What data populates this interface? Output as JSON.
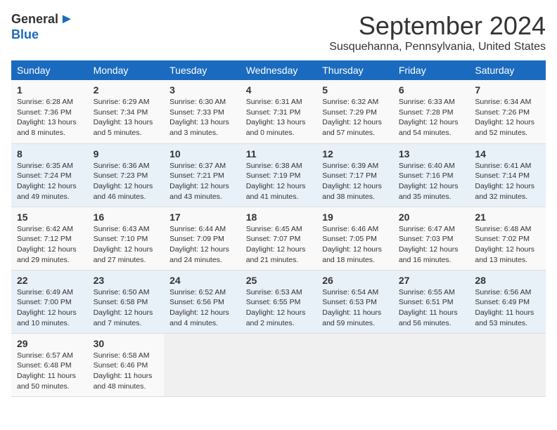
{
  "logo": {
    "general": "General",
    "blue": "Blue"
  },
  "title": "September 2024",
  "location": "Susquehanna, Pennsylvania, United States",
  "days_of_week": [
    "Sunday",
    "Monday",
    "Tuesday",
    "Wednesday",
    "Thursday",
    "Friday",
    "Saturday"
  ],
  "weeks": [
    [
      {
        "day": "1",
        "info": "Sunrise: 6:28 AM\nSunset: 7:36 PM\nDaylight: 13 hours\nand 8 minutes."
      },
      {
        "day": "2",
        "info": "Sunrise: 6:29 AM\nSunset: 7:34 PM\nDaylight: 13 hours\nand 5 minutes."
      },
      {
        "day": "3",
        "info": "Sunrise: 6:30 AM\nSunset: 7:33 PM\nDaylight: 13 hours\nand 3 minutes."
      },
      {
        "day": "4",
        "info": "Sunrise: 6:31 AM\nSunset: 7:31 PM\nDaylight: 13 hours\nand 0 minutes."
      },
      {
        "day": "5",
        "info": "Sunrise: 6:32 AM\nSunset: 7:29 PM\nDaylight: 12 hours\nand 57 minutes."
      },
      {
        "day": "6",
        "info": "Sunrise: 6:33 AM\nSunset: 7:28 PM\nDaylight: 12 hours\nand 54 minutes."
      },
      {
        "day": "7",
        "info": "Sunrise: 6:34 AM\nSunset: 7:26 PM\nDaylight: 12 hours\nand 52 minutes."
      }
    ],
    [
      {
        "day": "8",
        "info": "Sunrise: 6:35 AM\nSunset: 7:24 PM\nDaylight: 12 hours\nand 49 minutes."
      },
      {
        "day": "9",
        "info": "Sunrise: 6:36 AM\nSunset: 7:23 PM\nDaylight: 12 hours\nand 46 minutes."
      },
      {
        "day": "10",
        "info": "Sunrise: 6:37 AM\nSunset: 7:21 PM\nDaylight: 12 hours\nand 43 minutes."
      },
      {
        "day": "11",
        "info": "Sunrise: 6:38 AM\nSunset: 7:19 PM\nDaylight: 12 hours\nand 41 minutes."
      },
      {
        "day": "12",
        "info": "Sunrise: 6:39 AM\nSunset: 7:17 PM\nDaylight: 12 hours\nand 38 minutes."
      },
      {
        "day": "13",
        "info": "Sunrise: 6:40 AM\nSunset: 7:16 PM\nDaylight: 12 hours\nand 35 minutes."
      },
      {
        "day": "14",
        "info": "Sunrise: 6:41 AM\nSunset: 7:14 PM\nDaylight: 12 hours\nand 32 minutes."
      }
    ],
    [
      {
        "day": "15",
        "info": "Sunrise: 6:42 AM\nSunset: 7:12 PM\nDaylight: 12 hours\nand 29 minutes."
      },
      {
        "day": "16",
        "info": "Sunrise: 6:43 AM\nSunset: 7:10 PM\nDaylight: 12 hours\nand 27 minutes."
      },
      {
        "day": "17",
        "info": "Sunrise: 6:44 AM\nSunset: 7:09 PM\nDaylight: 12 hours\nand 24 minutes."
      },
      {
        "day": "18",
        "info": "Sunrise: 6:45 AM\nSunset: 7:07 PM\nDaylight: 12 hours\nand 21 minutes."
      },
      {
        "day": "19",
        "info": "Sunrise: 6:46 AM\nSunset: 7:05 PM\nDaylight: 12 hours\nand 18 minutes."
      },
      {
        "day": "20",
        "info": "Sunrise: 6:47 AM\nSunset: 7:03 PM\nDaylight: 12 hours\nand 16 minutes."
      },
      {
        "day": "21",
        "info": "Sunrise: 6:48 AM\nSunset: 7:02 PM\nDaylight: 12 hours\nand 13 minutes."
      }
    ],
    [
      {
        "day": "22",
        "info": "Sunrise: 6:49 AM\nSunset: 7:00 PM\nDaylight: 12 hours\nand 10 minutes."
      },
      {
        "day": "23",
        "info": "Sunrise: 6:50 AM\nSunset: 6:58 PM\nDaylight: 12 hours\nand 7 minutes."
      },
      {
        "day": "24",
        "info": "Sunrise: 6:52 AM\nSunset: 6:56 PM\nDaylight: 12 hours\nand 4 minutes."
      },
      {
        "day": "25",
        "info": "Sunrise: 6:53 AM\nSunset: 6:55 PM\nDaylight: 12 hours\nand 2 minutes."
      },
      {
        "day": "26",
        "info": "Sunrise: 6:54 AM\nSunset: 6:53 PM\nDaylight: 11 hours\nand 59 minutes."
      },
      {
        "day": "27",
        "info": "Sunrise: 6:55 AM\nSunset: 6:51 PM\nDaylight: 11 hours\nand 56 minutes."
      },
      {
        "day": "28",
        "info": "Sunrise: 6:56 AM\nSunset: 6:49 PM\nDaylight: 11 hours\nand 53 minutes."
      }
    ],
    [
      {
        "day": "29",
        "info": "Sunrise: 6:57 AM\nSunset: 6:48 PM\nDaylight: 11 hours\nand 50 minutes."
      },
      {
        "day": "30",
        "info": "Sunrise: 6:58 AM\nSunset: 6:46 PM\nDaylight: 11 hours\nand 48 minutes."
      },
      {
        "day": "",
        "info": ""
      },
      {
        "day": "",
        "info": ""
      },
      {
        "day": "",
        "info": ""
      },
      {
        "day": "",
        "info": ""
      },
      {
        "day": "",
        "info": ""
      }
    ]
  ]
}
